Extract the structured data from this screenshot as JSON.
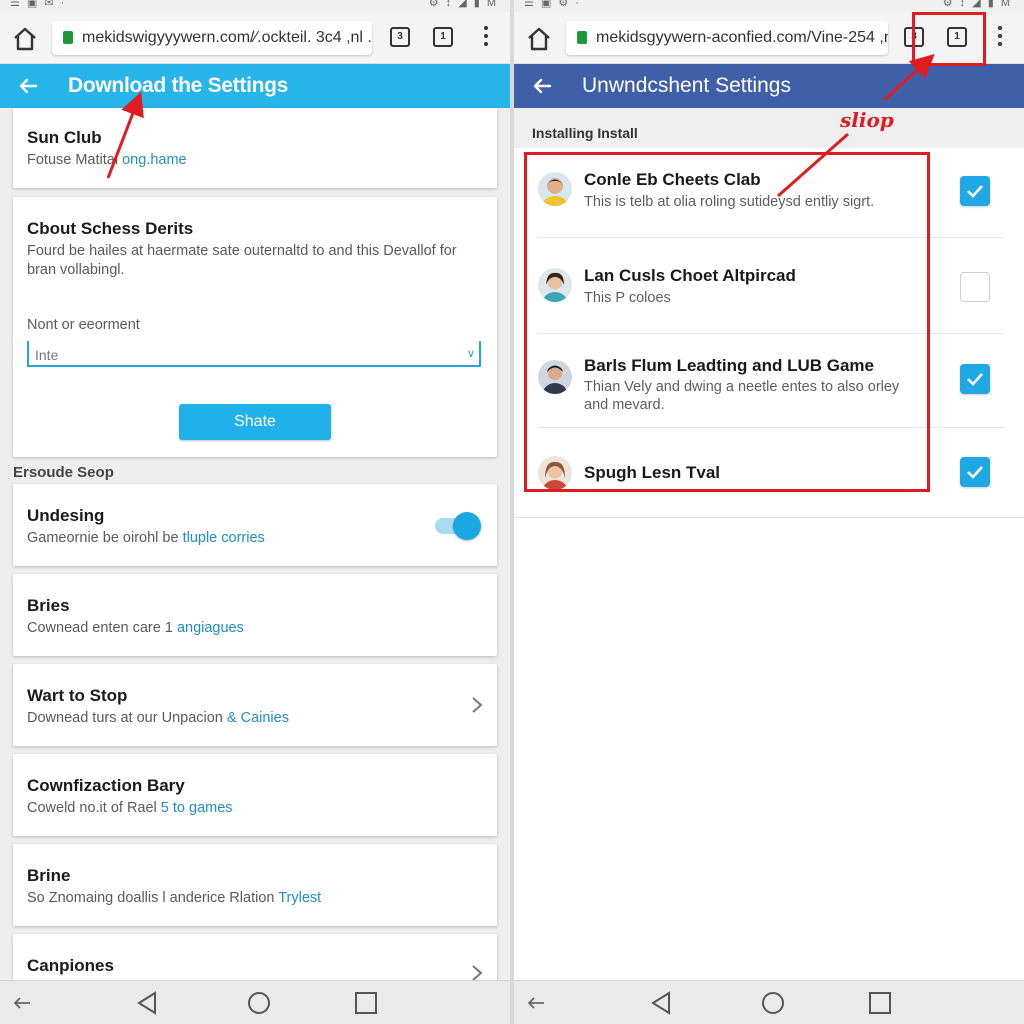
{
  "left": {
    "status": {
      "left": "☰ ▣ ✉ ·",
      "right": "⚙ ↕ ◢ ▮ M"
    },
    "url": "mekidswigyyywern.com/∕.ockteil. 3c4 ,nl ...",
    "tab_count": "3",
    "page_title": "Download the Settings",
    "cards": [
      {
        "title": "Sun Club",
        "sub": "Fotuse Matital ",
        "link": "ong.hame"
      },
      {
        "title": "Cbout Schess Derits",
        "body1": "Fourd be hailes at haermate sate outernaltd to and this Devallof for",
        "body2": "bran vollabingl.",
        "field_label": "Nont or eeorment",
        "field_value": "Inte",
        "button": "Shate"
      }
    ],
    "section": "Ersoude Seop",
    "rows": [
      {
        "title": "Undesing",
        "sub": "Gameornie be oirohl be ",
        "link": "tluple corries"
      },
      {
        "title": "Bries",
        "sub": "Cownead enten care 1 ",
        "link": "angiagues"
      },
      {
        "title": "Wart to Stop",
        "sub": "Downead turs at our Unpacion ",
        "link": "& Cainies"
      },
      {
        "title": "Cownfizaction Bary",
        "sub": "Coweld no.it of Rael ",
        "link": "5 to games"
      },
      {
        "title": "Brine",
        "sub": "So Znomaing doallis l anderice Rlation ",
        "link": "Trylest"
      },
      {
        "title": "Canpiones"
      }
    ]
  },
  "right": {
    "status": {
      "left": "☰ ▣ ⚙ ·",
      "right": "⚙ ↕ ◢ ▮ M"
    },
    "url": "mekidsgyywern-aconfied.com/Vine-254 ,nl ...",
    "tab_count": "1",
    "page_title": "Unwndcshent Settings",
    "section": "Installing Install",
    "items": [
      {
        "title": "Conle Eb Cheets Clab",
        "sub": "This is telb at olia roling sutideysd entliy sigrt.",
        "checked": true
      },
      {
        "title": "Lan Cusls Choet Altpircad",
        "sub": "This P coloes",
        "checked": false
      },
      {
        "title": "Barls Flum Leadting and LUB Game",
        "sub": "Thian Vely and dwing a neetle entes to also orley and mevard.",
        "checked": true
      },
      {
        "title": "Spugh Lesn Tval",
        "sub": "",
        "checked": true
      }
    ],
    "annotation": "sliop"
  },
  "colors": {
    "left_appbar": "#27b4e8",
    "right_appbar": "#3f5fa8",
    "accent": "#1fa8e4",
    "annotation": "#e01c23"
  }
}
